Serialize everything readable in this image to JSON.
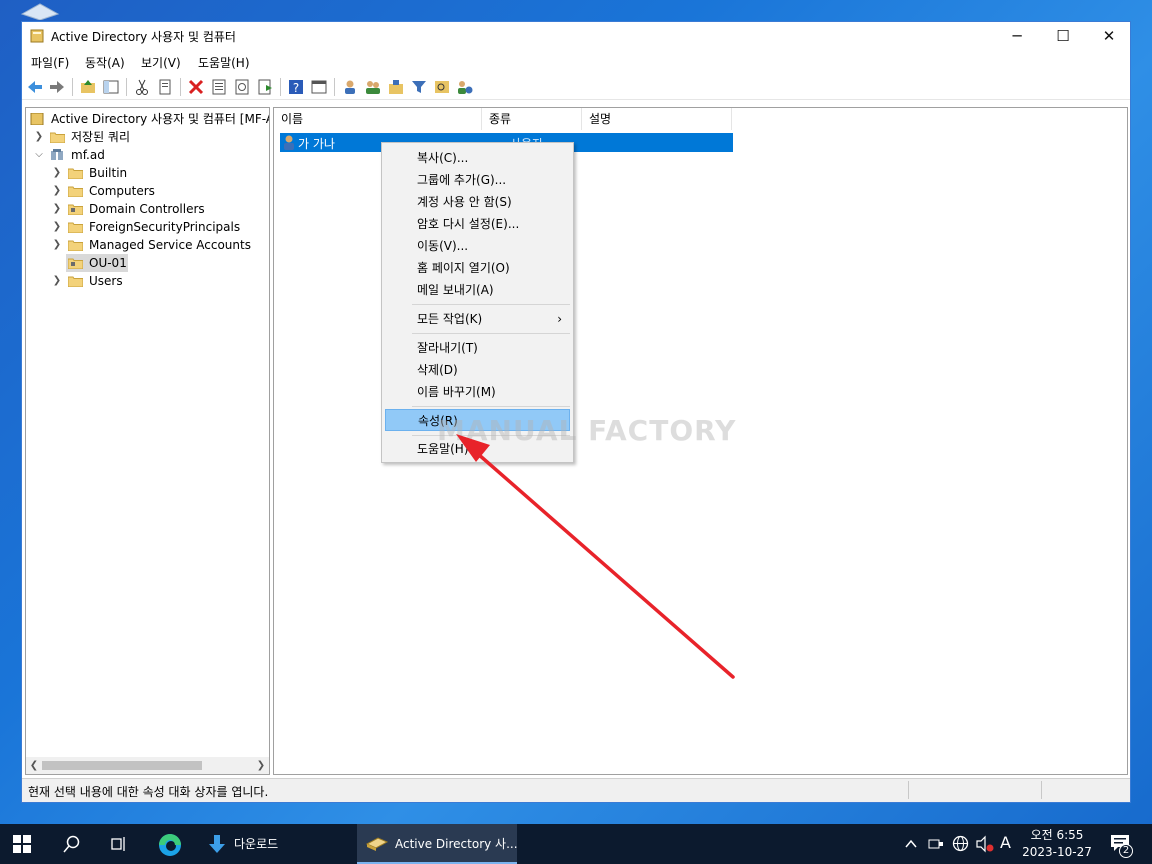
{
  "window": {
    "title": "Active Directory 사용자 및 컴퓨터",
    "min_glyph": "─",
    "max_glyph": "☐",
    "close_glyph": "✕"
  },
  "menu": [
    "파일(F)",
    "동작(A)",
    "보기(V)",
    "도움말(H)"
  ],
  "tree": {
    "root": "Active Directory 사용자 및 컴퓨터 [MF-A",
    "saved_queries": "저장된 쿼리",
    "domain": "mf.ad",
    "children": [
      "Builtin",
      "Computers",
      "Domain Controllers",
      "ForeignSecurityPrincipals",
      "Managed Service Accounts",
      "OU-01",
      "Users"
    ]
  },
  "list": {
    "columns": [
      "이름",
      "종류",
      "설명"
    ],
    "rows": [
      {
        "name": "가 가나",
        "type": "사용자"
      }
    ]
  },
  "context_menu": {
    "items": [
      "복사(C)...",
      "그룹에 추가(G)...",
      "계정 사용 안 함(S)",
      "암호 다시 설정(E)...",
      "이동(V)...",
      "홈 페이지 열기(O)",
      "메일 보내기(A)"
    ],
    "all_tasks": "모든 작업(K)",
    "all_tasks_arrow": "›",
    "edit_items": [
      "잘라내기(T)",
      "삭제(D)",
      "이름 바꾸기(M)"
    ],
    "properties": "속성(R)",
    "help": "도움말(H)"
  },
  "watermark": "MANUAL FACTORY",
  "status_text": "현재 선택 내용에 대한 속성 대화 상자를 엽니다.",
  "taskbar": {
    "downloads_label": "다운로드",
    "ad_label": "Active Directory 사...",
    "ime_label": "A",
    "time": "오전 6:55",
    "date": "2023-10-27",
    "notification_count": "2"
  },
  "colors": {
    "selection": "#0078d7",
    "menu_highlight": "#91c9f7",
    "arrow": "#e8232a",
    "taskbar": "#0c1a2e"
  }
}
